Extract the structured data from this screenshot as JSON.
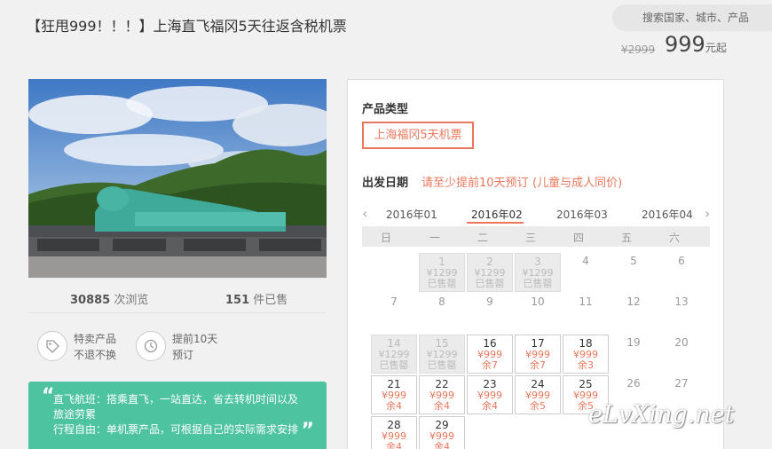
{
  "header": {
    "title": "【狂甩999！！！】上海直飞福冈5天往返含税机票",
    "search_placeholder": "搜索国家、城市、产品",
    "price_old": "¥2999",
    "price_new": "999",
    "price_unit": "元起"
  },
  "stats": {
    "views_count": "30885",
    "views_label": "次浏览",
    "sold_count": "151",
    "sold_label": "件已售"
  },
  "features": [
    {
      "icon": "tag-icon",
      "line1": "特卖产品",
      "line2": "不退不换"
    },
    {
      "icon": "clock-icon",
      "line1": "提前10天",
      "line2": "预订"
    }
  ],
  "notice": {
    "line1": "直飞航班：搭乘直飞，一站直达，省去转机时间以及",
    "line2": "旅途劳累",
    "line3": "行程自由：单机票产品，可根据自己的实际需求安排"
  },
  "booking": {
    "product_type_label": "产品类型",
    "product_option": "上海福冈5天机票",
    "departure_label": "出发日期",
    "note_advance": "请至少提前10天预订",
    "note_children": "(儿童与成人同价)",
    "months": [
      "2016年01",
      "2016年02",
      "2016年03",
      "2016年04"
    ],
    "selected_month": "2016年02",
    "weekdays": [
      "日",
      "一",
      "二",
      "三",
      "四",
      "五",
      "六"
    ],
    "days": [
      {
        "day": "1",
        "price": "¥1299",
        "status": "已售罄",
        "state": "sold"
      },
      {
        "day": "2",
        "price": "¥1299",
        "status": "已售罄",
        "state": "sold"
      },
      {
        "day": "3",
        "price": "¥1299",
        "status": "已售罄",
        "state": "sold"
      },
      {
        "day": "4",
        "state": "plain"
      },
      {
        "day": "5",
        "state": "plain"
      },
      {
        "day": "6",
        "state": "plain"
      },
      {
        "day": "7",
        "state": "plain"
      },
      {
        "day": "8",
        "state": "plain"
      },
      {
        "day": "9",
        "state": "plain"
      },
      {
        "day": "10",
        "state": "plain"
      },
      {
        "day": "11",
        "state": "plain"
      },
      {
        "day": "12",
        "state": "plain"
      },
      {
        "day": "13",
        "state": "plain"
      },
      {
        "day": "14",
        "price": "¥1299",
        "status": "已售罄",
        "state": "sold"
      },
      {
        "day": "15",
        "price": "¥1299",
        "status": "已售罄",
        "state": "sold"
      },
      {
        "day": "16",
        "price": "¥999",
        "status": "余7",
        "state": "avail"
      },
      {
        "day": "17",
        "price": "¥999",
        "status": "余7",
        "state": "avail"
      },
      {
        "day": "18",
        "price": "¥999",
        "status": "余3",
        "state": "avail"
      },
      {
        "day": "19",
        "state": "plain"
      },
      {
        "day": "20",
        "state": "plain"
      },
      {
        "day": "21",
        "price": "¥999",
        "status": "余4",
        "state": "avail"
      },
      {
        "day": "22",
        "price": "¥999",
        "status": "余4",
        "state": "avail"
      },
      {
        "day": "23",
        "price": "¥999",
        "status": "余4",
        "state": "avail"
      },
      {
        "day": "24",
        "price": "¥999",
        "status": "余5",
        "state": "avail"
      },
      {
        "day": "25",
        "price": "¥999",
        "status": "余5",
        "state": "avail"
      },
      {
        "day": "26",
        "state": "plain"
      },
      {
        "day": "27",
        "state": "plain"
      },
      {
        "day": "28",
        "price": "¥999",
        "status": "余4",
        "state": "avail"
      },
      {
        "day": "29",
        "price": "¥999",
        "status": "余4",
        "state": "avail"
      }
    ]
  },
  "watermark": "eLvXing.net",
  "colors": {
    "accent": "#e8785c",
    "notice_bg": "#4dc3a0"
  }
}
